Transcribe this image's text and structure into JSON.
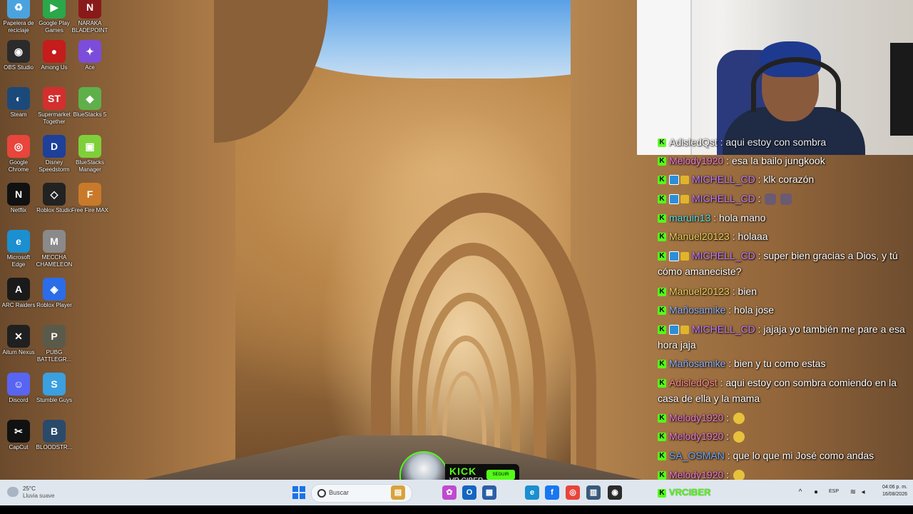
{
  "desktop_icons": [
    {
      "label": "Papelera de reciclaje",
      "icon": "recycle-bin-icon",
      "color": "#4aa3df",
      "glyph": "♻"
    },
    {
      "label": "Google Play Games",
      "icon": "google-play-games-icon",
      "color": "#2aa84a",
      "glyph": "▶"
    },
    {
      "label": "NARAKA BLADEPOINT",
      "icon": "naraka-icon",
      "color": "#8a1a1a",
      "glyph": "N"
    },
    {
      "label": "OBS Studio",
      "icon": "obs-icon",
      "color": "#2b2b2b",
      "glyph": "◉"
    },
    {
      "label": "Among Us",
      "icon": "among-us-icon",
      "color": "#c51c1c",
      "glyph": "●"
    },
    {
      "label": "Ace",
      "icon": "ace-icon",
      "color": "#7c4ddb",
      "glyph": "✦"
    },
    {
      "label": "Steam",
      "icon": "steam-icon",
      "color": "#1b4a7a",
      "glyph": "◐"
    },
    {
      "label": "Supermarket Together",
      "icon": "supermarket-together-icon",
      "color": "#d32f2f",
      "glyph": "ST"
    },
    {
      "label": "BlueStacks 5",
      "icon": "bluestacks-5-icon",
      "color": "#5fb04a",
      "glyph": "◆"
    },
    {
      "label": "Google Chrome",
      "icon": "chrome-icon",
      "color": "#e8453c",
      "glyph": "◎"
    },
    {
      "label": "Disney Speedstorm",
      "icon": "disney-speedstorm-icon",
      "color": "#1e3f9a",
      "glyph": "D"
    },
    {
      "label": "BlueStacks Manager",
      "icon": "bluestacks-manager-icon",
      "color": "#7fcf3a",
      "glyph": "▣"
    },
    {
      "label": "Netflix",
      "icon": "netflix-icon",
      "color": "#111111",
      "glyph": "N"
    },
    {
      "label": "Roblox Studio",
      "icon": "roblox-studio-icon",
      "color": "#222222",
      "glyph": "◇"
    },
    {
      "label": "Free Fire MAX",
      "icon": "free-fire-max-icon",
      "color": "#c87a2a",
      "glyph": "F"
    },
    {
      "label": "Microsoft Edge",
      "icon": "edge-icon",
      "color": "#1b8fd0",
      "glyph": "e"
    },
    {
      "label": "MECCHA CHAMELEON",
      "icon": "meccha-chameleon-icon",
      "color": "#8a8a8a",
      "glyph": "M"
    },
    {
      "label": "ARC Raiders",
      "icon": "arc-raiders-icon",
      "color": "#1a1a1a",
      "glyph": "A"
    },
    {
      "label": "Roblox Player",
      "icon": "roblox-player-icon",
      "color": "#2b6de8",
      "glyph": "◈"
    },
    {
      "label": "Aitum Nexus",
      "icon": "aitum-nexus-icon",
      "color": "#202020",
      "glyph": "✕"
    },
    {
      "label": "PUBG BATTLEGR...",
      "icon": "pubg-icon",
      "color": "#5a5a4a",
      "glyph": "P"
    },
    {
      "label": "Discord",
      "icon": "discord-icon",
      "color": "#5865f2",
      "glyph": "☺"
    },
    {
      "label": "Stumble Guys",
      "icon": "stumble-guys-icon",
      "color": "#3aa0e0",
      "glyph": "S"
    },
    {
      "label": "CapCut",
      "icon": "capcut-icon",
      "color": "#111111",
      "glyph": "✂"
    },
    {
      "label": "BLOODSTR...",
      "icon": "bloodstrike-icon",
      "color": "#2a4a6a",
      "glyph": "B"
    }
  ],
  "chat": {
    "partial_top": "AdisledQst : aqui estoy con sombra",
    "messages": [
      {
        "user": "Melody1920",
        "color": "#f47bd7",
        "text": ": esa la bailo jungkook",
        "badges": 1,
        "emotes": 0
      },
      {
        "user": "MICHELL_CD",
        "color": "#c77dff",
        "text": ": klk corazón",
        "badges": 3,
        "emotes": 0
      },
      {
        "user": "MICHELL_CD",
        "color": "#c77dff",
        "text": ":",
        "badges": 3,
        "emotes": 2,
        "emote_kind": "face"
      },
      {
        "user": "maruin13",
        "color": "#5ee0e6",
        "text": ": hola mano",
        "badges": 1,
        "emotes": 0
      },
      {
        "user": "Manuel20123",
        "color": "#f2d35c",
        "text": ": holaaa",
        "badges": 1,
        "emotes": 0
      },
      {
        "user": "MICHELL_CD",
        "color": "#c77dff",
        "text": ": super bien gracias a Dios, y tú cómo amaneciste?",
        "badges": 3,
        "emotes": 0
      },
      {
        "user": "Manuel20123",
        "color": "#f2d35c",
        "text": ": bien",
        "badges": 1,
        "emotes": 0
      },
      {
        "user": "Mañosamike",
        "color": "#8fb3ff",
        "text": ": hola jose",
        "badges": 1,
        "emotes": 0
      },
      {
        "user": "MICHELL_CD",
        "color": "#c77dff",
        "text": ": jajaja yo también me pare a esa hora jaja",
        "badges": 3,
        "emotes": 0
      },
      {
        "user": "Mañosamike",
        "color": "#8fb3ff",
        "text": ": bien y tu como estas",
        "badges": 1,
        "emotes": 0
      },
      {
        "user": "AdisledQst",
        "color": "#ff8a8a",
        "text": ": aqui estoy con sombra comiendo en la casa de ella y la mama",
        "badges": 1,
        "emotes": 0
      },
      {
        "user": "Melody1920",
        "color": "#f47bd7",
        "text": ":",
        "badges": 1,
        "emotes": 1,
        "emote_kind": "yellow"
      },
      {
        "user": "Melody1920",
        "color": "#f47bd7",
        "text": ":",
        "badges": 1,
        "emotes": 1,
        "emote_kind": "yellow"
      },
      {
        "user": "SA_OSMAN",
        "color": "#6fa8ff",
        "text": ": que lo que mi José como andas",
        "badges": 1,
        "emotes": 0
      },
      {
        "user": "Melody1920",
        "color": "#f47bd7",
        "text": ":",
        "badges": 1,
        "emotes": 1,
        "emote_kind": "yellow"
      }
    ]
  },
  "kick_overlay": {
    "logo": "KICK",
    "channel": "VR CIBER",
    "follow_label": "SEGUIR"
  },
  "taskbar": {
    "weather_temp": "25°C",
    "weather_desc": "Lluvia suave",
    "search_placeholder": "Buscar",
    "kick_channel": "VRCIBER",
    "language": "ESP",
    "time": "04:06 p. m.",
    "date": "16/08/2026",
    "apps": [
      {
        "name": "taskbar-files-app-icon",
        "color": "#d7a33c",
        "glyph": "▤"
      },
      {
        "name": "taskbar-copilot-icon",
        "color": "#c04ad1",
        "glyph": "✿"
      },
      {
        "name": "taskbar-outlook-icon",
        "color": "#1466c2",
        "glyph": "O"
      },
      {
        "name": "taskbar-store-icon",
        "color": "#2b5ea8",
        "glyph": "▦"
      },
      {
        "name": "taskbar-edge-icon",
        "color": "#1b8fd0",
        "glyph": "e"
      },
      {
        "name": "taskbar-facebook-icon",
        "color": "#1877f2",
        "glyph": "f"
      },
      {
        "name": "taskbar-chrome-icon",
        "color": "#e8453c",
        "glyph": "◎"
      },
      {
        "name": "taskbar-notepad-icon",
        "color": "#3a5a7a",
        "glyph": "▥"
      },
      {
        "name": "taskbar-obs-icon",
        "color": "#2b2b2b",
        "glyph": "◉"
      }
    ]
  }
}
